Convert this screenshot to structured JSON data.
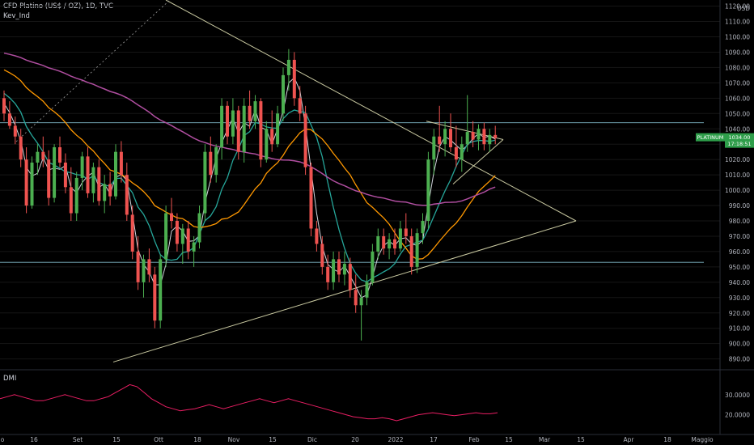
{
  "header": {
    "title": "CFD Platino (US$ / OZ), 1D, TVC",
    "indicator": "Kev_Ind"
  },
  "dmi_label": "DMI",
  "colors": {
    "background": "#000000",
    "up": "#26a69a",
    "up_candle": "#4caf50",
    "down": "#ef5350",
    "ma_fast": "#d1d4dc",
    "ma_mid": "#26a69a",
    "ma_slow": "#ff9800",
    "ma_long": "#b04ea0",
    "trendline": "#c8c8a0",
    "dmi": "#e91e63",
    "price_tag": "#2e9e4a"
  },
  "chart_data": [
    {
      "type": "candlestick",
      "name_tag": "PLATINUM",
      "last_price": "1034.00",
      "countdown": "17:18:51",
      "currency": "USD",
      "ylim": [
        884,
        1124
      ],
      "y_ticks": [
        "890.00",
        "900.00",
        "910.00",
        "920.00",
        "930.00",
        "940.00",
        "950.00",
        "960.00",
        "970.00",
        "980.00",
        "990.00",
        "1000.00",
        "1010.00",
        "1020.00",
        "1030.00",
        "1040.00",
        "1050.00",
        "1060.00",
        "1070.00",
        "1080.00",
        "1090.00",
        "1100.00",
        "1110.00",
        "1120.00"
      ],
      "x_ticks": [
        "o",
        "16",
        "Set",
        "15",
        "Ott",
        "18",
        "Nov",
        "15",
        "Dic",
        "20",
        "2022",
        "17",
        "Feb",
        "15",
        "Mar",
        "15",
        "Apr",
        "18",
        "Maggio"
      ],
      "horizontal_levels": [
        1044,
        953
      ],
      "trendlines": [
        {
          "from": [
            "t0",
            1130
          ],
          "to": [
            "t-apex",
            980
          ]
        },
        {
          "from": [
            "t-start",
            888
          ],
          "to": [
            "t-apex",
            980
          ]
        }
      ],
      "candles": [
        [
          1060,
          1065,
          1045,
          1050
        ],
        [
          1050,
          1058,
          1040,
          1042
        ],
        [
          1042,
          1048,
          1030,
          1035
        ],
        [
          1035,
          1040,
          1015,
          1020
        ],
        [
          1020,
          1028,
          985,
          990
        ],
        [
          990,
          1022,
          988,
          1018
        ],
        [
          1018,
          1030,
          1010,
          1025
        ],
        [
          1025,
          1035,
          1015,
          1020
        ],
        [
          1020,
          1026,
          990,
          995
        ],
        [
          995,
          1030,
          992,
          1028
        ],
        [
          1028,
          1035,
          1015,
          1018
        ],
        [
          1018,
          1024,
          998,
          1002
        ],
        [
          1002,
          1015,
          980,
          985
        ],
        [
          985,
          1012,
          980,
          1008
        ],
        [
          1008,
          1025,
          1000,
          1022
        ],
        [
          1022,
          1028,
          995,
          998
        ],
        [
          998,
          1018,
          992,
          1015
        ],
        [
          1015,
          1020,
          990,
          993
        ],
        [
          993,
          1010,
          985,
          1004
        ],
        [
          1004,
          1012,
          990,
          996
        ],
        [
          996,
          1030,
          994,
          1025
        ],
        [
          1025,
          1032,
          1005,
          1010
        ],
        [
          1010,
          1018,
          980,
          984
        ],
        [
          984,
          990,
          955,
          960
        ],
        [
          960,
          970,
          935,
          940
        ],
        [
          940,
          958,
          930,
          955
        ],
        [
          955,
          962,
          940,
          945
        ],
        [
          945,
          950,
          910,
          915
        ],
        [
          915,
          958,
          910,
          955
        ],
        [
          955,
          990,
          950,
          985
        ],
        [
          985,
          995,
          975,
          980
        ],
        [
          980,
          985,
          960,
          965
        ],
        [
          965,
          978,
          952,
          975
        ],
        [
          975,
          980,
          955,
          960
        ],
        [
          960,
          970,
          950,
          966
        ],
        [
          966,
          990,
          962,
          985
        ],
        [
          985,
          1030,
          980,
          1025
        ],
        [
          1025,
          1035,
          1005,
          1010
        ],
        [
          1010,
          1030,
          1005,
          1028
        ],
        [
          1028,
          1060,
          1020,
          1055
        ],
        [
          1055,
          1058,
          1030,
          1035
        ],
        [
          1035,
          1060,
          1030,
          1052
        ],
        [
          1052,
          1055,
          1020,
          1025
        ],
        [
          1025,
          1060,
          1018,
          1055
        ],
        [
          1055,
          1065,
          1040,
          1045
        ],
        [
          1045,
          1062,
          1040,
          1058
        ],
        [
          1058,
          1060,
          1015,
          1020
        ],
        [
          1020,
          1045,
          1018,
          1040
        ],
        [
          1040,
          1052,
          1025,
          1030
        ],
        [
          1030,
          1055,
          1028,
          1050
        ],
        [
          1050,
          1080,
          1045,
          1075
        ],
        [
          1075,
          1092,
          1065,
          1085
        ],
        [
          1085,
          1090,
          1055,
          1060
        ],
        [
          1060,
          1068,
          1045,
          1050
        ],
        [
          1050,
          1055,
          1010,
          1015
        ],
        [
          1015,
          1018,
          970,
          975
        ],
        [
          975,
          980,
          960,
          965
        ],
        [
          965,
          970,
          945,
          950
        ],
        [
          950,
          958,
          935,
          940
        ],
        [
          940,
          960,
          935,
          955
        ],
        [
          955,
          960,
          940,
          945
        ],
        [
          945,
          960,
          938,
          952
        ],
        [
          952,
          956,
          930,
          935
        ],
        [
          935,
          945,
          920,
          925
        ],
        [
          925,
          935,
          902,
          930
        ],
        [
          930,
          945,
          925,
          940
        ],
        [
          940,
          965,
          938,
          960
        ],
        [
          960,
          975,
          955,
          970
        ],
        [
          970,
          975,
          958,
          962
        ],
        [
          962,
          972,
          955,
          968
        ],
        [
          968,
          975,
          958,
          962
        ],
        [
          962,
          980,
          960,
          975
        ],
        [
          975,
          985,
          965,
          970
        ],
        [
          970,
          975,
          945,
          950
        ],
        [
          950,
          975,
          946,
          972
        ],
        [
          972,
          985,
          965,
          980
        ],
        [
          980,
          1025,
          975,
          1020
        ],
        [
          1020,
          1040,
          1010,
          1035
        ],
        [
          1035,
          1055,
          1025,
          1030
        ],
        [
          1030,
          1045,
          1022,
          1040
        ],
        [
          1040,
          1050,
          1025,
          1028
        ],
        [
          1028,
          1042,
          1015,
          1020
        ],
        [
          1020,
          1035,
          1012,
          1030
        ],
        [
          1030,
          1062,
          1025,
          1038
        ],
        [
          1038,
          1045,
          1028,
          1033
        ],
        [
          1033,
          1043,
          1026,
          1040
        ],
        [
          1040,
          1044,
          1026,
          1030
        ],
        [
          1030,
          1040,
          1025,
          1036
        ],
        [
          1036,
          1042,
          1030,
          1034
        ]
      ]
    },
    {
      "type": "line",
      "name": "DMI",
      "ylim": [
        15,
        38
      ],
      "y_ticks": [
        "20.0000",
        "30.0000"
      ],
      "values": [
        28,
        29,
        30,
        29,
        28,
        27,
        27,
        28,
        29,
        30,
        29,
        28,
        27,
        27,
        28,
        29,
        31,
        33,
        35,
        34,
        31,
        28,
        26,
        24,
        23,
        22,
        22.5,
        23,
        24,
        25,
        24,
        23,
        24,
        25,
        26,
        27,
        28,
        27,
        26,
        27,
        28,
        27,
        26,
        25,
        24,
        23,
        22,
        21,
        20,
        19,
        18.5,
        18,
        18,
        18.5,
        18,
        17,
        18,
        19,
        20,
        20.5,
        21,
        20.5,
        20,
        19.5,
        20,
        20.5,
        21,
        20.5,
        20.5,
        21
      ]
    }
  ]
}
